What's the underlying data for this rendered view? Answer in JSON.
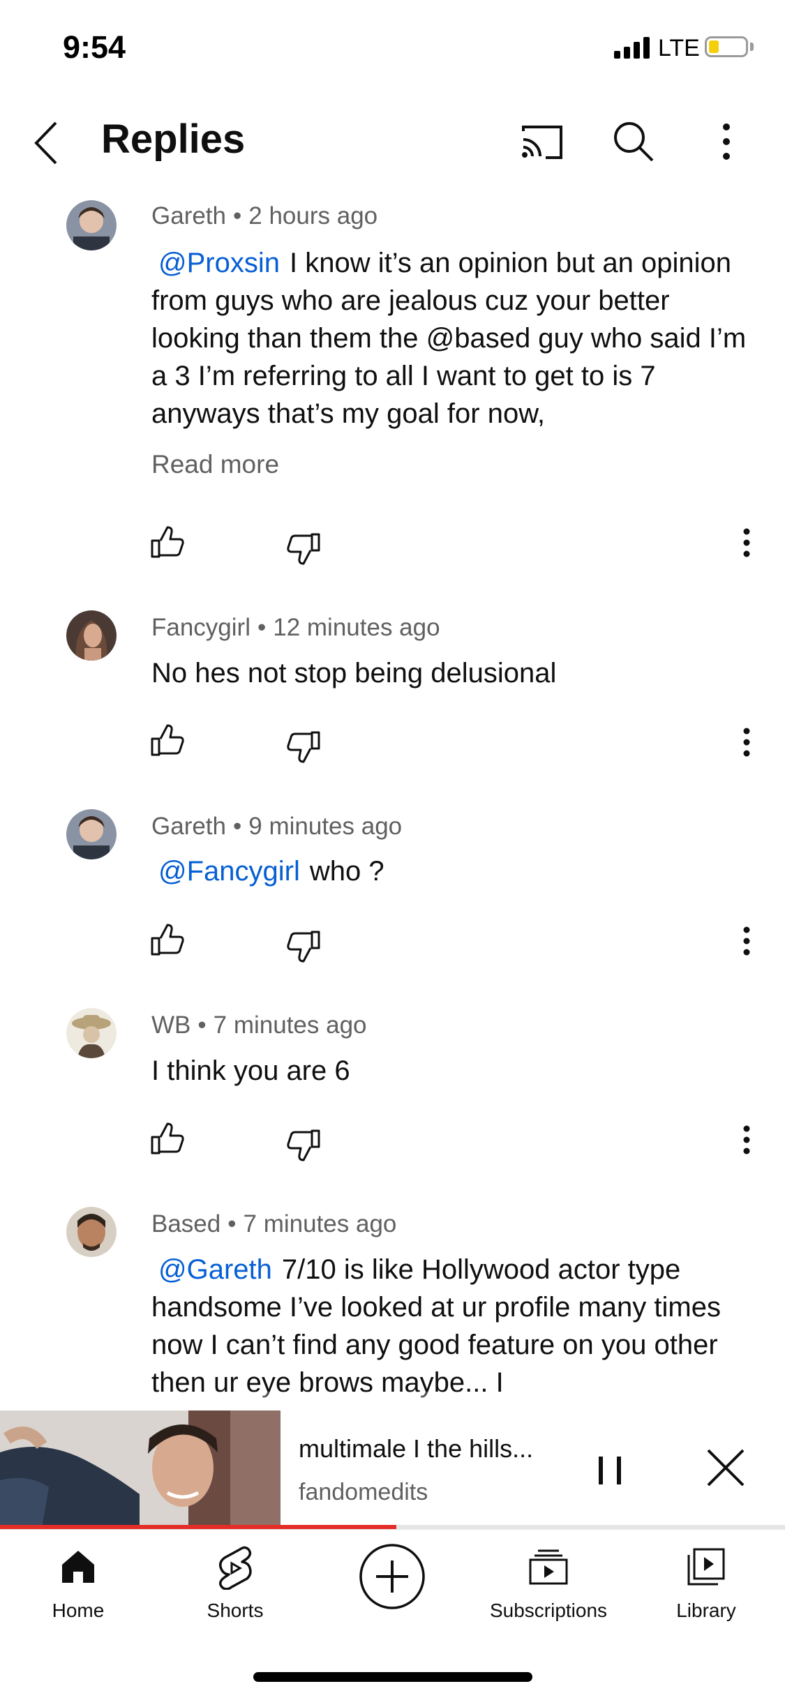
{
  "status_bar": {
    "time": "9:54",
    "network": "LTE"
  },
  "header": {
    "title": "Replies"
  },
  "comments": [
    {
      "author": "Gareth",
      "time": "2 hours ago",
      "mention": "@Proxsin",
      "text": "I know it’s an opinion but an opinion from guys who are jealous cuz your better looking than them the @based guy who said I’m a 3 I’m referring to all I want to get to is 7 anyways that’s my goal for now,",
      "read_more": "Read more"
    },
    {
      "author": "Fancygirl",
      "time": "12 minutes ago",
      "text": "No hes not stop being delusional"
    },
    {
      "author": "Gareth",
      "time": "9 minutes ago",
      "mention": "@Fancygirl",
      "text": "who ?"
    },
    {
      "author": "WB",
      "time": "7 minutes ago",
      "text": "I think you are 6"
    },
    {
      "author": "Based",
      "time": "7 minutes ago",
      "mention": "@Gareth",
      "text": "7/10 is like Hollywood actor type handsome I’ve looked at ur profile many times now I can’t find any good feature on you other then ur eye brows maybe... I"
    }
  ],
  "mini_player": {
    "title": "multimale I the hills...",
    "channel": "fandomedits",
    "progress": 0.505
  },
  "bottom_nav": {
    "home": "Home",
    "shorts": "Shorts",
    "subscriptions": "Subscriptions",
    "library": "Library"
  },
  "colors": {
    "mention": "#065fd4",
    "progress": "#e52d27",
    "battery": "#f5cf0b",
    "secondary_text": "#606060"
  }
}
